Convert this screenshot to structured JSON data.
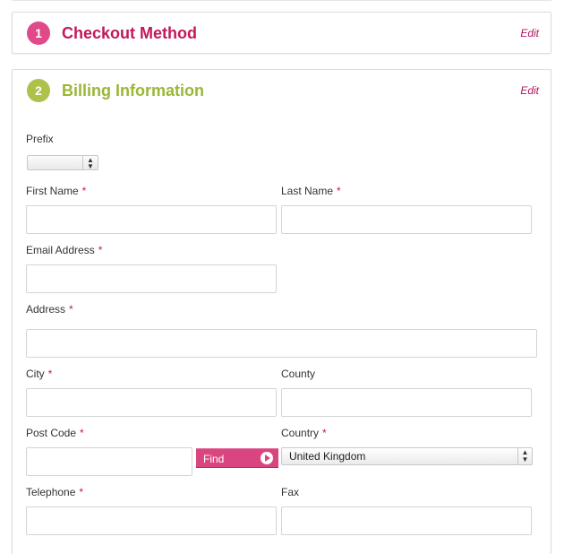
{
  "steps": [
    {
      "number": "1",
      "title": "Checkout Method",
      "edit_label": "Edit"
    },
    {
      "number": "2",
      "title": "Billing Information",
      "edit_label": "Edit"
    }
  ],
  "billing_form": {
    "prefix": {
      "label": "Prefix",
      "selected": ""
    },
    "first_name": {
      "label": "First Name",
      "required_mark": "*",
      "value": ""
    },
    "last_name": {
      "label": "Last Name",
      "required_mark": "*",
      "value": ""
    },
    "email": {
      "label": "Email Address",
      "required_mark": "*",
      "value": ""
    },
    "address": {
      "label": "Address",
      "required_mark": "*",
      "value": ""
    },
    "city": {
      "label": "City",
      "required_mark": "*",
      "value": ""
    },
    "county": {
      "label": "County",
      "value": ""
    },
    "post_code": {
      "label": "Post Code",
      "required_mark": "*",
      "value": ""
    },
    "find_button": {
      "label": "Find",
      "icon": "play-circle-icon"
    },
    "country": {
      "label": "Country",
      "required_mark": "*",
      "selected": "United Kingdom"
    },
    "telephone": {
      "label": "Telephone",
      "required_mark": "*",
      "value": ""
    },
    "fax": {
      "label": "Fax",
      "value": ""
    }
  },
  "colors": {
    "step1_accent": "#c2185b",
    "step2_accent": "#9ab636",
    "required": "#c2185b",
    "find_button": "#d9467f"
  }
}
